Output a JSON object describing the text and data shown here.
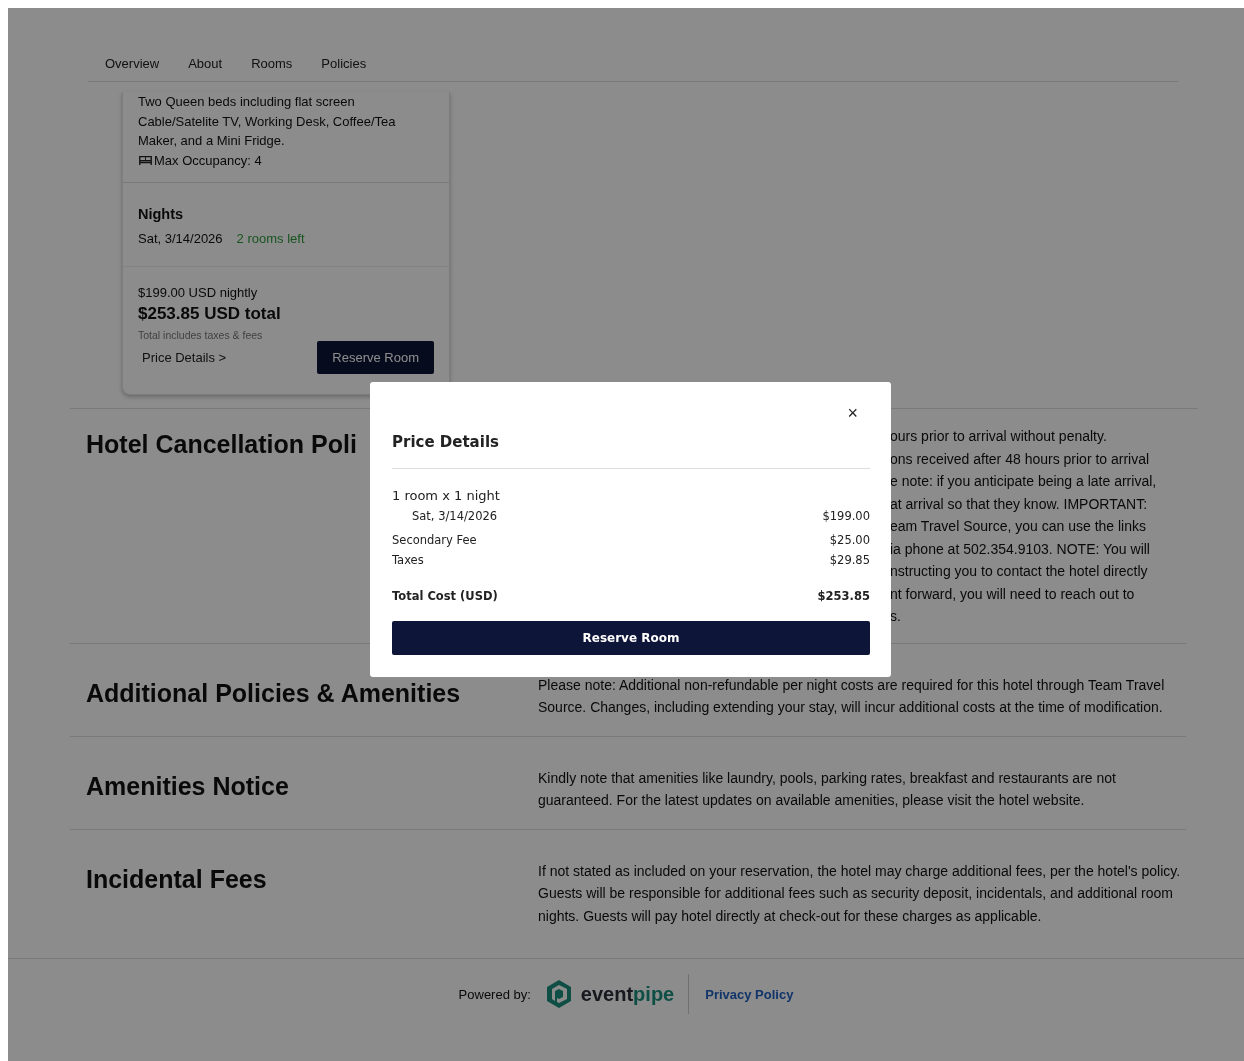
{
  "tabs": [
    {
      "label": "Overview"
    },
    {
      "label": "About"
    },
    {
      "label": "Rooms"
    },
    {
      "label": "Policies"
    }
  ],
  "room_card": {
    "description": [
      "Two Queen beds including flat screen",
      "Cable/Satelite TV, Working Desk, Coffee/Tea",
      "Maker, and a Mini Fridge."
    ],
    "occupancy": "Max Occupancy: 4",
    "nights_title": "Nights",
    "night_date": "Sat, 3/14/2026",
    "availability": "2 rooms left",
    "nightly": "$199.00 USD nightly",
    "total": "$253.85 USD total",
    "total_note": "Total includes taxes & fees",
    "price_details_link": "Price Details >",
    "reserve_button": "Reserve Room"
  },
  "sections": [
    {
      "title": "Hotel Cancellation Poli",
      "lines": [
        "ours prior to arrival without penalty.",
        "ons received after 48 hours prior to arrival",
        "e note: if you anticipate being a late arrival,",
        "at arrival so that they know. IMPORTANT:",
        "eam Travel Source, you can use the links",
        "ia phone at 502.354.9103. NOTE: You will",
        "nstructing you to contact the hotel directly",
        "nt forward, you will need to reach out to",
        "s."
      ]
    },
    {
      "title": "Additional Policies & Amenities",
      "text": "Please note: Additional non-refundable per night costs are required for this hotel through Team Travel Source. Changes, including extending your stay, will incur additional costs at the time of modification."
    },
    {
      "title": "Amenities Notice",
      "text": "Kindly note that amenities like laundry, pools, parking rates, breakfast and restaurants are not guaranteed. For the latest updates on available amenities, please visit the hotel website."
    },
    {
      "title": "Incidental Fees",
      "text": "If not stated as included on your reservation, the hotel may charge additional fees, per the hotel's policy. Guests will be responsible for additional fees such as security deposit, incidentals, and additional room nights. Guests will pay hotel directly at check-out for these charges as applicable."
    }
  ],
  "footer": {
    "powered_by": "Powered by:",
    "logo_parts": [
      "event",
      "pipe"
    ],
    "privacy_link": "Privacy Policy"
  },
  "modal": {
    "title": "Price Details",
    "close": "×",
    "room_line": "1 room x 1 night",
    "rows": [
      {
        "kind": "night",
        "label": "Sat, 3/14/2026",
        "amount": "$199.00"
      },
      {
        "kind": "fee",
        "label": "Secondary Fee",
        "amount": "$25.00"
      },
      {
        "kind": "fee",
        "label": "Taxes",
        "amount": "$29.85"
      },
      {
        "kind": "total",
        "label": "Total Cost (USD)",
        "amount": "$253.85"
      }
    ],
    "reserve_button": "Reserve Room"
  }
}
